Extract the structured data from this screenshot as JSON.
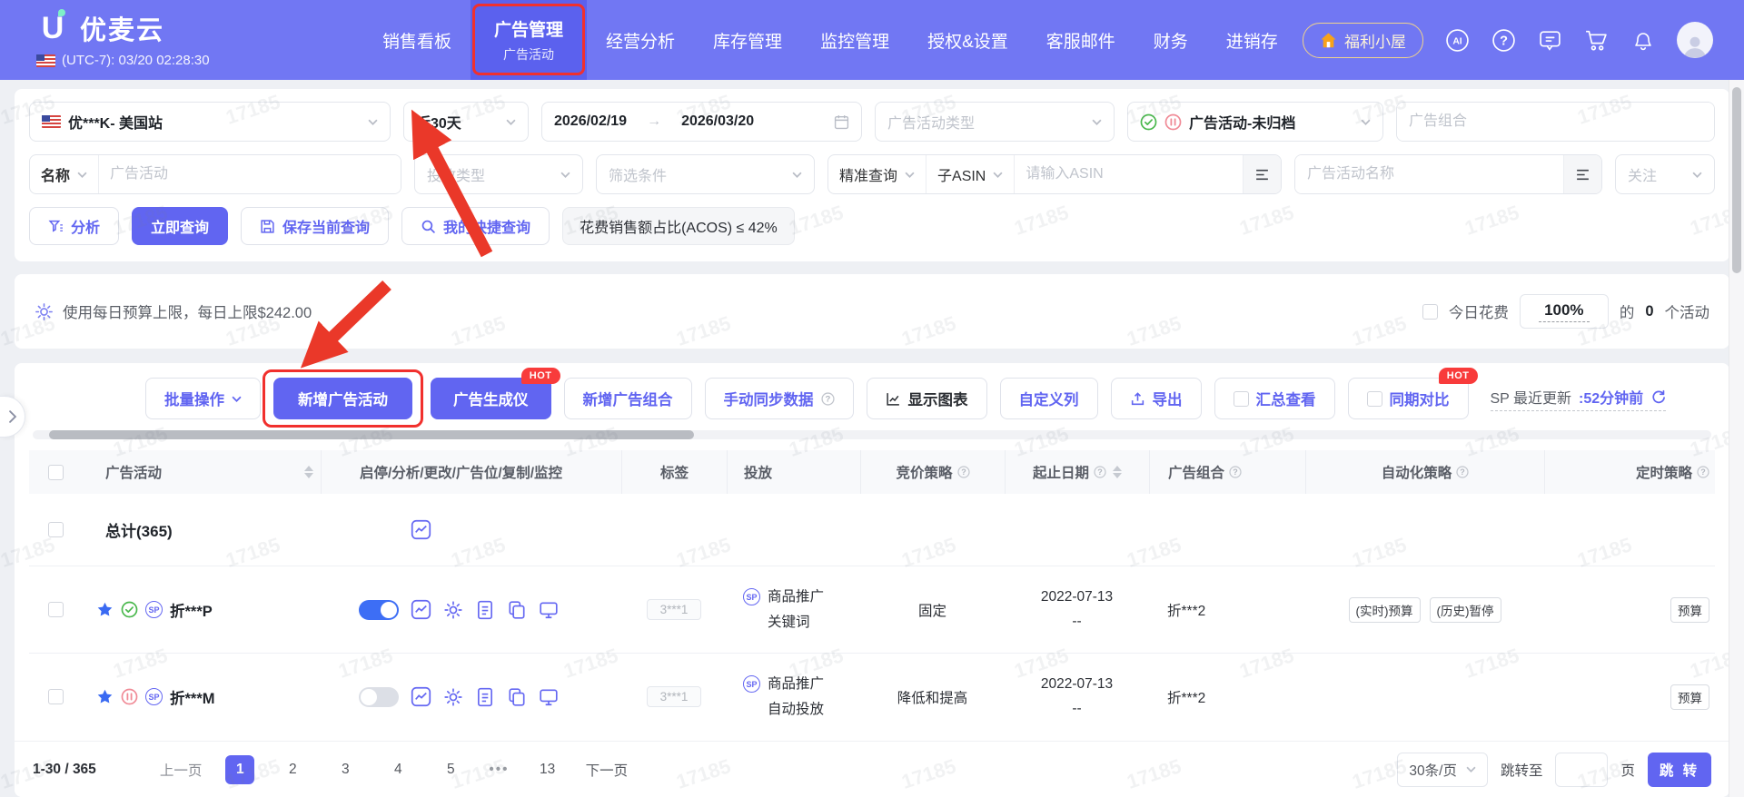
{
  "page": {
    "watermark": "17185"
  },
  "colors": {
    "header": "#7177f3",
    "accent": "#6165f1",
    "hot": "#f83b3b",
    "annotation": "#ea3829",
    "green": "#49b84c",
    "pink": "#f08a96",
    "star_blue": "#3a6af2"
  },
  "topbar": {
    "brand": "优麦云",
    "timezone": "(UTC-7): 03/20 02:28:30",
    "nav": [
      {
        "label": "销售看板"
      },
      {
        "label": "广告管理",
        "subtitle": "广告活动"
      },
      {
        "label": "经营分析"
      },
      {
        "label": "库存管理"
      },
      {
        "label": "监控管理"
      },
      {
        "label": "授权&设置"
      },
      {
        "label": "客服邮件"
      },
      {
        "label": "财务"
      },
      {
        "label": "进销存"
      }
    ],
    "welfare_label": "福利小屋",
    "ai_label": "AI"
  },
  "filters": {
    "row1": {
      "site": "优***K- 美国站",
      "range": "近30天",
      "date_start": "2026/02/19",
      "date_arrow": "→",
      "date_end": "2026/03/20",
      "campaign_type_placeholder": "广告活动类型",
      "status": "广告活动-未归档",
      "portfolio_placeholder": "广告组合"
    },
    "row2": {
      "name_field": "名称",
      "campaign_placeholder": "广告活动",
      "targeting_type_placeholder": "投放类型",
      "filter_placeholder": "筛选条件",
      "exact_query": "精准查询",
      "sub_asin": "子ASIN",
      "asin_placeholder": "请输入ASIN",
      "campaign_name_placeholder": "广告活动名称",
      "follow_placeholder": "关注"
    },
    "row3": {
      "analyze": "分析",
      "query_now": "立即查询",
      "save_query": "保存当前查询",
      "my_quick_query": "我的快捷查询",
      "acos_chip": "花费销售额占比(ACOS) ≤ 42%"
    }
  },
  "budget_bar": {
    "text": "使用每日预算上限，每日上限$242.00",
    "today_spend_label": "今日花费",
    "percent": "100%",
    "of_label": "的",
    "count": "0",
    "unit_label": "个活动"
  },
  "toolbar": {
    "batch": "批量操作",
    "new_campaign": "新增广告活动",
    "ad_generator": "广告生成仪",
    "new_portfolio": "新增广告组合",
    "manual_sync": "手动同步数据",
    "show_chart": "显示图表",
    "custom_columns": "自定义列",
    "export": "导出",
    "summary_view": "汇总查看",
    "period_compare": "同期对比",
    "hot": "HOT",
    "sp_update_prefix": "SP 最近更新",
    "sp_update_time": ":52分钟前"
  },
  "table": {
    "columns": [
      {
        "label": "广告活动"
      },
      {
        "label": "启停/分析/更改/广告位/复制/监控"
      },
      {
        "label": "标签"
      },
      {
        "label": "投放"
      },
      {
        "label": "竞价策略"
      },
      {
        "label": "起止日期"
      },
      {
        "label": "广告组合"
      },
      {
        "label": "自动化策略"
      },
      {
        "label": "定时策略"
      }
    ],
    "total_label": "总计(365)",
    "rows": [
      {
        "name": "折***P",
        "badge": "SP",
        "tag": "3***1",
        "product_type": "商品推广",
        "targeting": "关键词",
        "bid_strategy": "固定",
        "date_start": "2022-07-13",
        "date_end": "--",
        "portfolio": "折***2",
        "auto_tags": [
          "(实时)预算",
          "(历史)暂停"
        ],
        "timer_tag": "预算"
      },
      {
        "name": "折***M",
        "badge": "SP",
        "tag": "3***1",
        "product_type": "商品推广",
        "targeting": "自动投放",
        "bid_strategy": "降低和提高",
        "date_start": "2022-07-13",
        "date_end": "--",
        "portfolio": "折***2",
        "auto_tags": [],
        "timer_tag": "预算"
      }
    ]
  },
  "pagination": {
    "total": "1-30 / 365",
    "prev": "上一页",
    "pages": [
      "1",
      "2",
      "3",
      "4",
      "5"
    ],
    "ellipsis": "•••",
    "last_page": "13",
    "next": "下一页",
    "page_size": "30条/页",
    "jump_label": "跳转至",
    "jump_unit": "页",
    "jump_button": "跳 转"
  }
}
